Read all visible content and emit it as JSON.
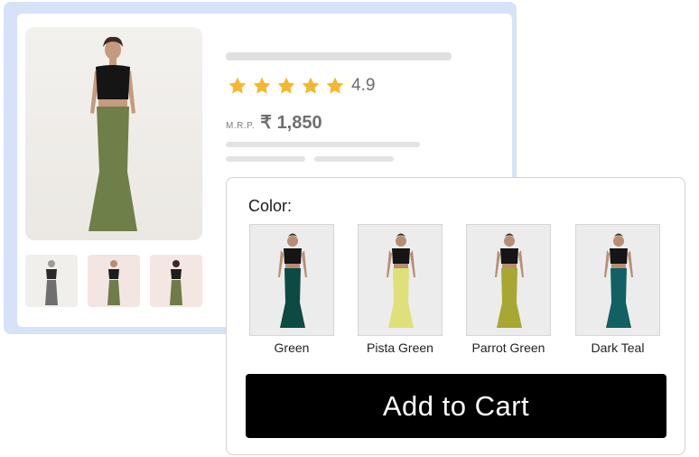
{
  "product": {
    "rating": "4.9",
    "stars": 5,
    "mrp_label": "M.R.P.",
    "price": "₹ 1,850",
    "main_skirt_color": "#6e7f4a",
    "thumbnail_skirt_colors": [
      "#6f6f6f",
      "#707c4a",
      "#6d7c48"
    ]
  },
  "color_picker": {
    "label": "Color:",
    "options": [
      {
        "name": "Green",
        "color": "#0e4a44"
      },
      {
        "name": "Pista Green",
        "color": "#dfe07a"
      },
      {
        "name": "Parrot Green",
        "color": "#a9a734"
      },
      {
        "name": "Dark Teal",
        "color": "#126063"
      }
    ]
  },
  "cart": {
    "button_label": "Add to Cart"
  },
  "colors": {
    "star": "#f5b72e",
    "back_frame": "#d6e2f7",
    "button": "#000000"
  }
}
